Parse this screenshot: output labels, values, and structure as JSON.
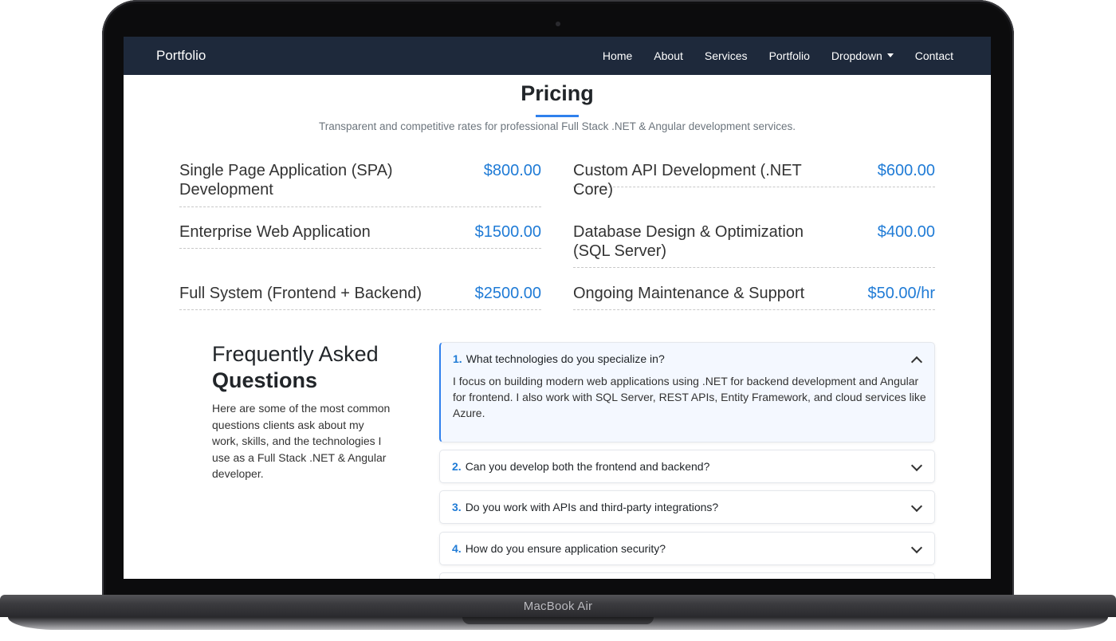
{
  "device": {
    "model_label": "MacBook Air"
  },
  "navbar": {
    "brand": "Portfolio",
    "links": [
      "Home",
      "About",
      "Services",
      "Portfolio",
      "Dropdown",
      "Contact"
    ]
  },
  "pricing": {
    "title": "Pricing",
    "subtitle": "Transparent and competitive rates for professional Full Stack .NET & Angular development services.",
    "items": [
      {
        "name": "Single Page Application (SPA) Development",
        "price": "$800.00"
      },
      {
        "name": "Custom API Development (.NET Core)",
        "price": "$600.00"
      },
      {
        "name": "Enterprise Web Application",
        "price": "$1500.00"
      },
      {
        "name": "Database Design & Optimization (SQL Server)",
        "price": "$400.00"
      },
      {
        "name": "Full System (Frontend + Backend)",
        "price": "$2500.00"
      },
      {
        "name": "Ongoing Maintenance & Support",
        "price": "$50.00/hr"
      }
    ]
  },
  "faq": {
    "heading_light": "Frequently Asked",
    "heading_bold": "Questions",
    "intro": "Here are some of the most common questions clients ask about my work, skills, and the technologies I use as a Full Stack .NET & Angular developer.",
    "items": [
      {
        "number": "1.",
        "question": "What technologies do you specialize in?",
        "answer": "I focus on building modern web applications using .NET for backend development and Angular for frontend. I also work with SQL Server, REST APIs, Entity Framework, and cloud services like Azure."
      },
      {
        "number": "2.",
        "question": "Can you develop both the frontend and backend?"
      },
      {
        "number": "3.",
        "question": "Do you work with APIs and third-party integrations?"
      },
      {
        "number": "4.",
        "question": "How do you ensure application security?"
      }
    ]
  },
  "colors": {
    "navbar_bg": "#1e293b",
    "accent": "#2f80ed",
    "price": "#1f7bd6"
  }
}
